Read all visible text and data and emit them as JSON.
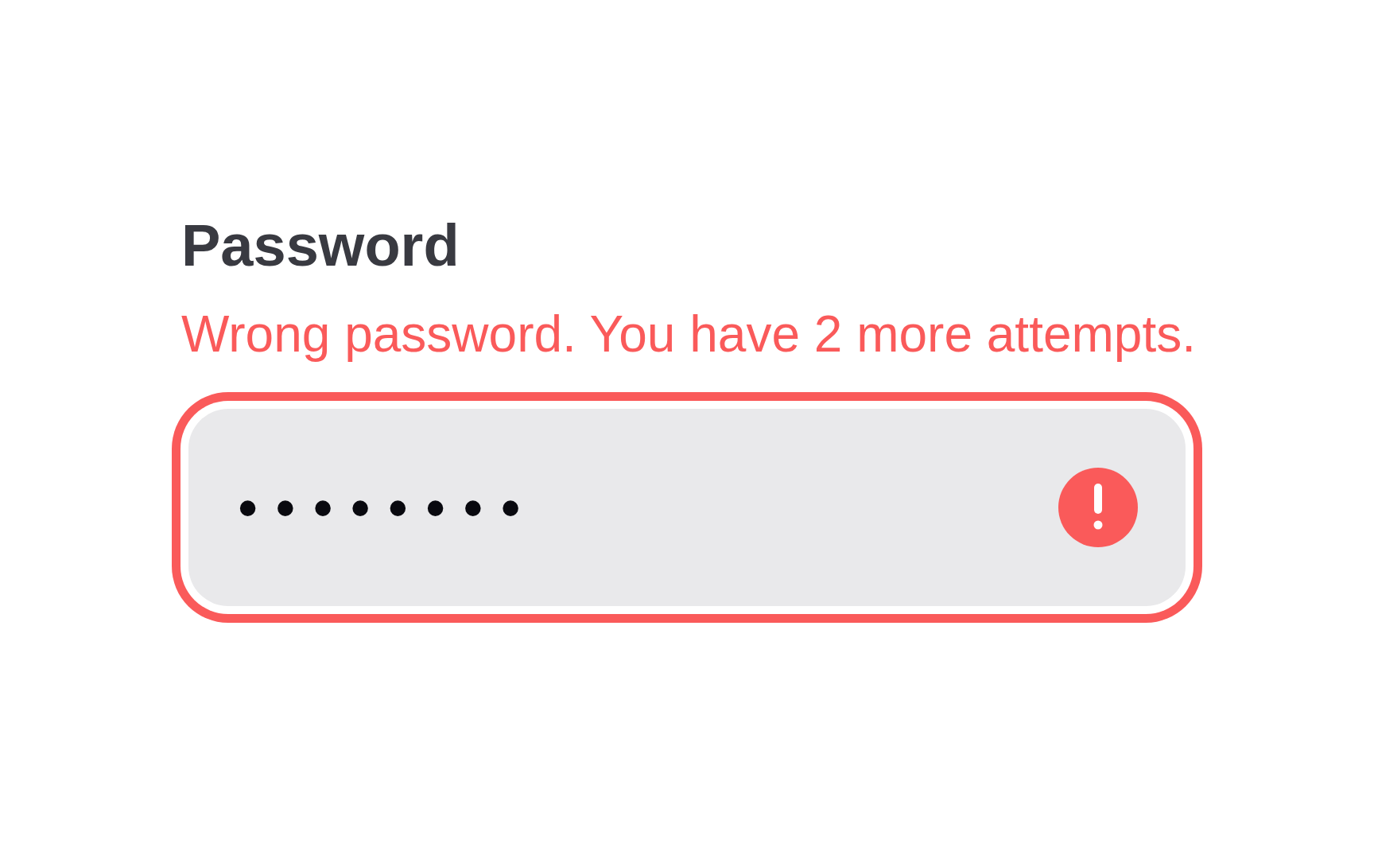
{
  "label": "Password",
  "error": "Wrong password. You have 2 more attempts.",
  "field": {
    "value": "••••••••",
    "invalid": true
  }
}
